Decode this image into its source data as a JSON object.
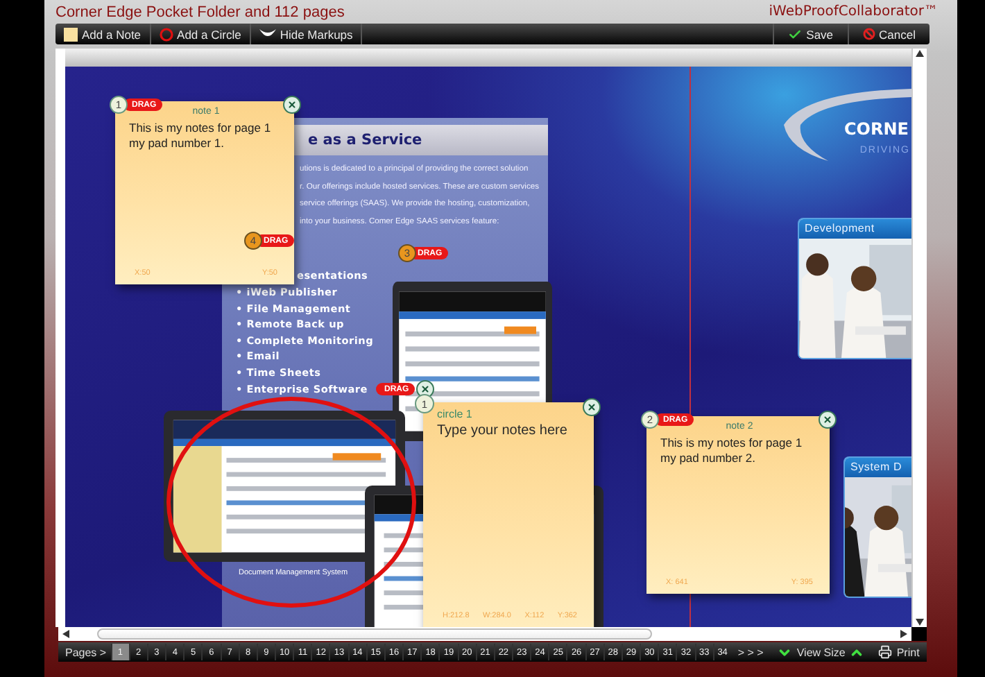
{
  "window": {
    "title": "Corner Edge Pocket Folder and 112 pages",
    "brand": "iWebProofCollaborator™"
  },
  "toolbar": {
    "tools": [
      {
        "kind": "note",
        "label": "Add a Note"
      },
      {
        "kind": "circle",
        "label": "Add a Circle"
      },
      {
        "kind": "hide",
        "label": "Hide Markups"
      }
    ],
    "actions": [
      {
        "kind": "save",
        "label": "Save"
      },
      {
        "kind": "cancel",
        "label": "Cancel"
      }
    ]
  },
  "document": {
    "heading": "e as a Service",
    "paragraph": "utions is dedicated to a principal of providing the correct solution\nr. Our offerings include hosted services. These are custom services\nservice offerings (SAAS). We provide the hosting, customization,\ninto your business. Comer Edge SAAS services feature:",
    "bullets": [
      "esentations",
      "• iWeb Publisher",
      "• File Management",
      "• Remote Back up",
      "• Complete Monitoring",
      "• Email",
      "• Time Sheets",
      "• Enterprise Software"
    ],
    "caption": "Document Management System",
    "logo": {
      "name": "CORNE",
      "tagline": "DRIVING"
    },
    "cards": [
      {
        "title": "Development"
      },
      {
        "title": "System D"
      }
    ]
  },
  "markups": [
    {
      "kind": "note",
      "number": "1",
      "color": "#eef2dc",
      "drag": "DRAG",
      "title": "note 1",
      "text": "This is my notes for page 1\nmy pad number 1.",
      "footer": [
        "X:50",
        "Y:50"
      ]
    },
    {
      "kind": "pin",
      "number": "4",
      "color": "#e8961e",
      "drag": "DRAG"
    },
    {
      "kind": "pin",
      "number": "3",
      "color": "#e8961e",
      "drag": "DRAG"
    },
    {
      "kind": "circle",
      "number": "1",
      "color": "#eef2dc",
      "drag": "DRAG",
      "title": "circle 1",
      "placeholder": "Type your notes here",
      "footer": [
        "H:212.8",
        "W:284.0",
        "X:112",
        "Y:362"
      ]
    },
    {
      "kind": "note",
      "number": "2",
      "color": "#eef2dc",
      "drag": "DRAG",
      "title": "note 2",
      "text": "This is my notes for page 1\nmy pad number 2.",
      "footer": [
        "X: 641",
        "Y: 395"
      ]
    }
  ],
  "pager": {
    "label": "Pages >",
    "more": "> > >",
    "view_size": "View Size",
    "print": "Print",
    "pages": [
      {
        "label": "1",
        "selected": true
      },
      {
        "label": "2",
        "selected": false
      },
      {
        "label": "3",
        "selected": false
      },
      {
        "label": "4",
        "selected": false
      },
      {
        "label": "5",
        "selected": false
      },
      {
        "label": "6",
        "selected": false
      },
      {
        "label": "7",
        "selected": false
      },
      {
        "label": "8",
        "selected": false
      },
      {
        "label": "9",
        "selected": false
      },
      {
        "label": "10",
        "selected": false
      },
      {
        "label": "11",
        "selected": false
      },
      {
        "label": "12",
        "selected": false
      },
      {
        "label": "13",
        "selected": false
      },
      {
        "label": "14",
        "selected": false
      },
      {
        "label": "15",
        "selected": false
      },
      {
        "label": "16",
        "selected": false
      },
      {
        "label": "17",
        "selected": false
      },
      {
        "label": "18",
        "selected": false
      },
      {
        "label": "19",
        "selected": false
      },
      {
        "label": "20",
        "selected": false
      },
      {
        "label": "21",
        "selected": false
      },
      {
        "label": "22",
        "selected": false
      },
      {
        "label": "23",
        "selected": false
      },
      {
        "label": "24",
        "selected": false
      },
      {
        "label": "25",
        "selected": false
      },
      {
        "label": "26",
        "selected": false
      },
      {
        "label": "27",
        "selected": false
      },
      {
        "label": "28",
        "selected": false
      },
      {
        "label": "29",
        "selected": false
      },
      {
        "label": "30",
        "selected": false
      },
      {
        "label": "31",
        "selected": false
      },
      {
        "label": "32",
        "selected": false
      },
      {
        "label": "33",
        "selected": false
      },
      {
        "label": "34",
        "selected": false
      }
    ]
  }
}
